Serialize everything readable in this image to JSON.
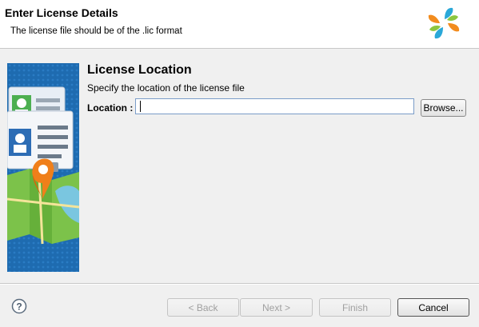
{
  "header": {
    "title": "Enter License Details",
    "subtitle": "The license file should be of the .lic format",
    "logo_icon": "pinwheel-logo"
  },
  "main": {
    "section_title": "License Location",
    "section_desc": "Specify the location of the license file",
    "location_label": "Location :",
    "location_value": "",
    "browse_label": "Browse..."
  },
  "footer": {
    "help_icon": "help-icon",
    "back_label": "< Back",
    "next_label": "Next >",
    "finish_label": "Finish",
    "cancel_label": "Cancel"
  },
  "colors": {
    "sidebar_blue": "#1f6fb5",
    "input_border": "#7a9cc8"
  }
}
